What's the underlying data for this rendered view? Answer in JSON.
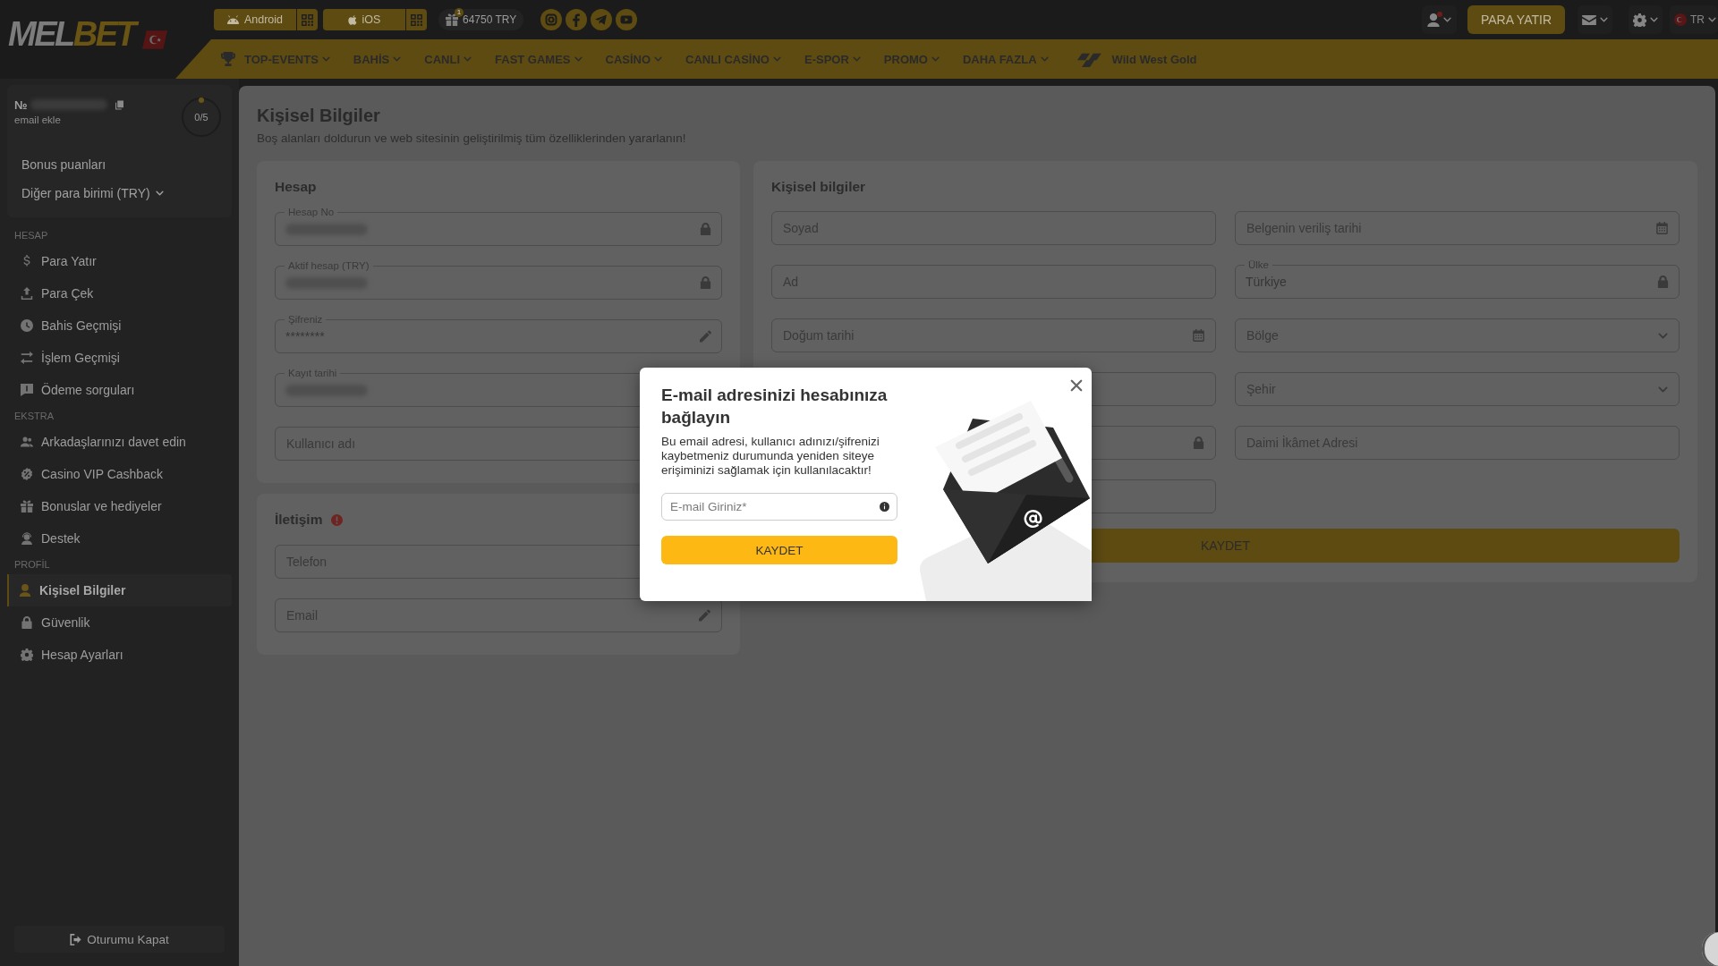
{
  "header": {
    "logo": [
      {
        "text": "MEL",
        "accent": false
      },
      {
        "text": "BET",
        "accent": true
      }
    ],
    "app_links": [
      {
        "label": "Android"
      },
      {
        "label": "iOS"
      }
    ],
    "bonus": {
      "badge": "1",
      "amount": "64750 TRY"
    },
    "profile": {
      "notification": true
    },
    "deposit_button": "PARA YATIR",
    "language": "TR"
  },
  "nav": {
    "items": [
      {
        "label": "TOP-EVENTS"
      },
      {
        "label": "BAHİS"
      },
      {
        "label": "CANLI"
      },
      {
        "label": "FAST GAMES"
      },
      {
        "label": "CASİNO"
      },
      {
        "label": "CANLI CASİNO"
      },
      {
        "label": "E-SPOR"
      },
      {
        "label": "PROMO"
      },
      {
        "label": "DAHA FAZLA"
      }
    ],
    "featured": "Wild West Gold"
  },
  "sidebar": {
    "account": {
      "number_prefix": "№",
      "blurred": true,
      "email_link": "email ekle",
      "progress": "0/5"
    },
    "bonus_link": "Bonus puanları",
    "currency_select": "Diğer para birimi (TRY)",
    "sections": [
      {
        "title": "HESAP",
        "items": [
          {
            "label": "Para Yatır",
            "selected": false
          },
          {
            "label": "Para Çek",
            "selected": false
          },
          {
            "label": "Bahis Geçmişi",
            "selected": false
          },
          {
            "label": "İşlem Geçmişi",
            "selected": false
          },
          {
            "label": "Ödeme sorguları",
            "selected": false
          }
        ]
      },
      {
        "title": "EKSTRA",
        "items": [
          {
            "label": "Arkadaşlarınızı davet edin",
            "selected": false
          },
          {
            "label": "Casino VIP Cashback",
            "selected": false
          },
          {
            "label": "Bonuslar ve hediyeler",
            "selected": false
          },
          {
            "label": "Destek",
            "selected": false
          }
        ]
      },
      {
        "title": "PROFİL",
        "items": [
          {
            "label": "Kişisel Bilgiler",
            "selected": true
          },
          {
            "label": "Güvenlik",
            "selected": false
          },
          {
            "label": "Hesap Ayarları",
            "selected": false
          }
        ]
      }
    ],
    "logout": "Oturumu Kapat"
  },
  "content": {
    "title": "Kişisel Bilgiler",
    "subtitle": "Boş alanları doldurun ve web sitesinin geliştirilmiş tüm özelliklerinden yararlanın!",
    "account_card": {
      "title": "Hesap",
      "fields": [
        {
          "label": "Hesap No",
          "blurred": true,
          "kind": "locked"
        },
        {
          "label": "Aktif hesap (TRY)",
          "blurred": true,
          "kind": "locked"
        },
        {
          "label": "Şifreniz",
          "value": "********",
          "blurred": false,
          "kind": "editable"
        },
        {
          "label": "Kayıt tarihi",
          "blurred": true,
          "kind": "text"
        },
        {
          "placeholder": "Kullanıcı adı",
          "blurred": false,
          "kind": "text"
        }
      ]
    },
    "contact_card": {
      "title": "İletişim",
      "warning": true,
      "fields": [
        {
          "placeholder": "Telefon",
          "kind": "text"
        },
        {
          "placeholder": "Email",
          "kind": "editable"
        }
      ]
    },
    "personal_card": {
      "title": "Kişisel bilgiler",
      "columns": [
        {
          "fields": [
            {
              "placeholder": "Soyad",
              "kind": "text"
            },
            {
              "placeholder": "Ad",
              "kind": "text"
            },
            {
              "placeholder": "Doğum tarihi",
              "kind": "date"
            },
            {
              "kind": "text"
            },
            {
              "kind": "locked"
            },
            {
              "kind": "text"
            }
          ]
        },
        {
          "fields": [
            {
              "placeholder": "Belgenin veriliş tarihi",
              "kind": "date"
            },
            {
              "label": "Ülke",
              "value": "Türkiye",
              "kind": "locked"
            },
            {
              "placeholder": "Bölge",
              "kind": "select"
            },
            {
              "placeholder": "Şehir",
              "kind": "select"
            },
            {
              "placeholder": "Daimi İkâmet Adresi",
              "kind": "text"
            }
          ]
        }
      ],
      "save_button": "KAYDET"
    }
  },
  "modal": {
    "title": "E-mail adresinizi hesabınıza bağlayın",
    "text": "Bu email adresi, kullanıcı adınızı/şifrenizi kaybetmeniz durumunda yeniden siteye erişiminizi sağlamak için kullanılacaktır!",
    "input": {
      "placeholder": "E-mail Giriniz*"
    },
    "button": "KAYDET"
  }
}
